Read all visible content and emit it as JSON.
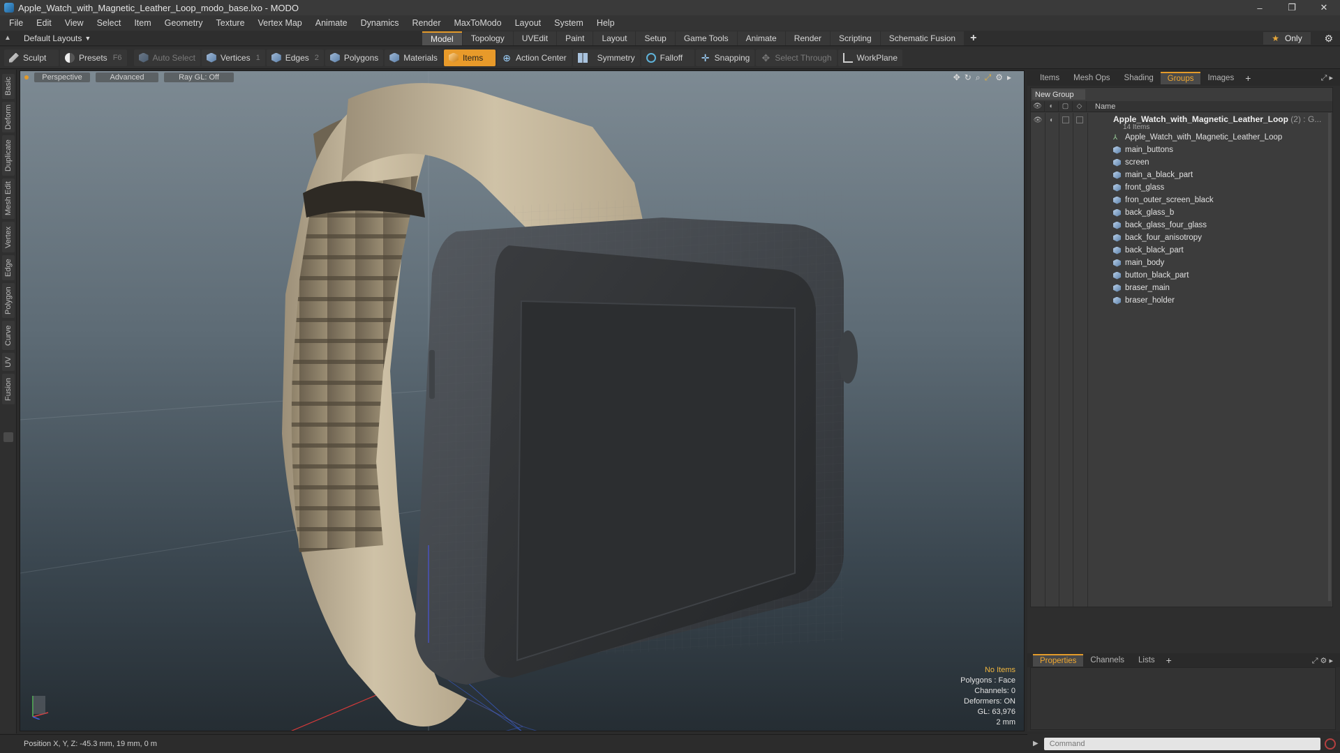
{
  "window": {
    "title": "Apple_Watch_with_Magnetic_Leather_Loop_modo_base.lxo - MODO",
    "controls": [
      "–",
      "❐",
      "✕"
    ]
  },
  "menu": [
    "File",
    "Edit",
    "View",
    "Select",
    "Item",
    "Geometry",
    "Texture",
    "Vertex Map",
    "Animate",
    "Dynamics",
    "Render",
    "MaxToModo",
    "Layout",
    "System",
    "Help"
  ],
  "layout_selector": "Default Layouts",
  "mode_tabs": [
    "Model",
    "Topology",
    "UVEdit",
    "Paint",
    "Layout",
    "Setup",
    "Game Tools",
    "Animate",
    "Render",
    "Scripting",
    "Schematic Fusion"
  ],
  "active_mode_tab": "Model",
  "only_label": "Only",
  "toolbar": {
    "sculpt": "Sculpt",
    "presets": "Presets",
    "presets_key": "F6",
    "auto_select": "Auto Select",
    "vertices": "Vertices",
    "vertices_count": "1",
    "edges": "Edges",
    "edges_count": "2",
    "polygons": "Polygons",
    "materials": "Materials",
    "items": "Items",
    "action_center": "Action Center",
    "symmetry": "Symmetry",
    "falloff": "Falloff",
    "snapping": "Snapping",
    "select_through": "Select Through",
    "workplane": "WorkPlane"
  },
  "left_tabs": [
    "Basic",
    "Deform",
    "Duplicate",
    "Mesh Edit",
    "Vertex",
    "Edge",
    "Polygon",
    "Curve",
    "UV",
    "Fusion"
  ],
  "viewport": {
    "view": "Perspective",
    "shading": "Advanced",
    "raygl": "Ray GL: Off",
    "info": {
      "selection": "No Items",
      "polygons": "Polygons : Face",
      "channels": "Channels: 0",
      "deformers": "Deformers: ON",
      "gl": "GL: 63,976",
      "scale": "2 mm"
    }
  },
  "right_panel": {
    "tabs": [
      "Items",
      "Mesh Ops",
      "Shading",
      "Groups",
      "Images"
    ],
    "active_tab": "Groups",
    "new_group": "New Group",
    "name_header": "Name",
    "root": {
      "name": "Apple_Watch_with_Magnetic_Leather_Loop",
      "count": " (2) : G...",
      "sub": "14 Items"
    },
    "items": [
      "Apple_Watch_with_Magnetic_Leather_Loop",
      "main_buttons",
      "screen",
      "main_a_black_part",
      "front_glass",
      "fron_outer_screen_black",
      "back_glass_b",
      "back_glass_four_glass",
      "back_four_anisotropy",
      "back_black_part",
      "main_body",
      "button_black_part",
      "braser_main",
      "braser_holder"
    ],
    "bottom_tabs": [
      "Properties",
      "Channels",
      "Lists"
    ],
    "active_bottom_tab": "Properties"
  },
  "status": {
    "position": "Position X, Y, Z:  -45.3 mm, 19 mm, 0 m"
  },
  "command": {
    "placeholder": "Command"
  }
}
